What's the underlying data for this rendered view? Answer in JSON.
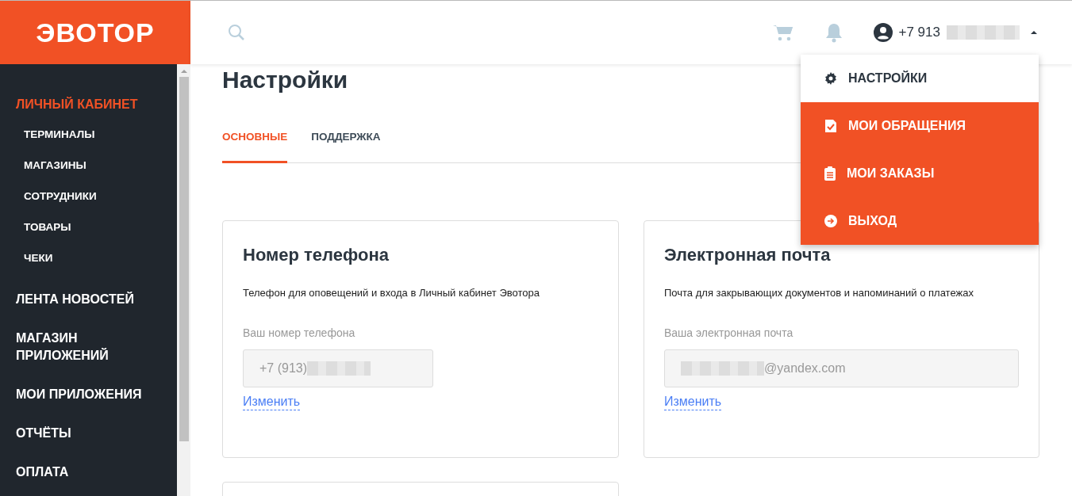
{
  "logo": "ЭВОТОР",
  "header": {
    "account": "+7 913"
  },
  "user_menu": [
    {
      "label": "НАСТРОЙКИ",
      "selected": true
    },
    {
      "label": "МОИ ОБРАЩЕНИЯ",
      "selected": false
    },
    {
      "label": "МОИ ЗАКАЗЫ",
      "selected": false
    },
    {
      "label": "ВЫХОД",
      "selected": false
    }
  ],
  "sidebar": {
    "items": [
      {
        "label": "ЛИЧНЫЙ КАБИНЕТ",
        "selected": true,
        "children": [
          {
            "label": "ТЕРМИНАЛЫ"
          },
          {
            "label": "МАГАЗИНЫ"
          },
          {
            "label": "СОТРУДНИКИ"
          },
          {
            "label": "ТОВАРЫ"
          },
          {
            "label": "ЧЕКИ"
          }
        ]
      },
      {
        "label": "ЛЕНТА НОВОСТЕЙ",
        "selected": false
      },
      {
        "label": "МАГАЗИН ПРИЛОЖЕНИЙ",
        "selected": false
      },
      {
        "label": "МОИ ПРИЛОЖЕНИЯ",
        "selected": false
      },
      {
        "label": "ОТЧЁТЫ",
        "selected": false
      },
      {
        "label": "ОПЛАТА",
        "selected": false
      }
    ]
  },
  "page_title": "Настройки",
  "tabs": [
    {
      "label": "ОСНОВНЫЕ",
      "selected": true
    },
    {
      "label": "ПОДДЕРЖКА",
      "selected": false
    }
  ],
  "cards": [
    {
      "title": "Номер телефона",
      "description": "Телефон для оповещений и входа в Личный кабинет Эвотора",
      "field_label": "Ваш номер телефона",
      "value_before": "+7 (913)",
      "link": "Изменить"
    },
    {
      "title": "Электронная почта",
      "description": "Почта для закрывающих документов и напоминаний о платежах",
      "field_label": "Ваша электронная почта",
      "value_after": "@yandex.com",
      "link": "Изменить"
    }
  ]
}
